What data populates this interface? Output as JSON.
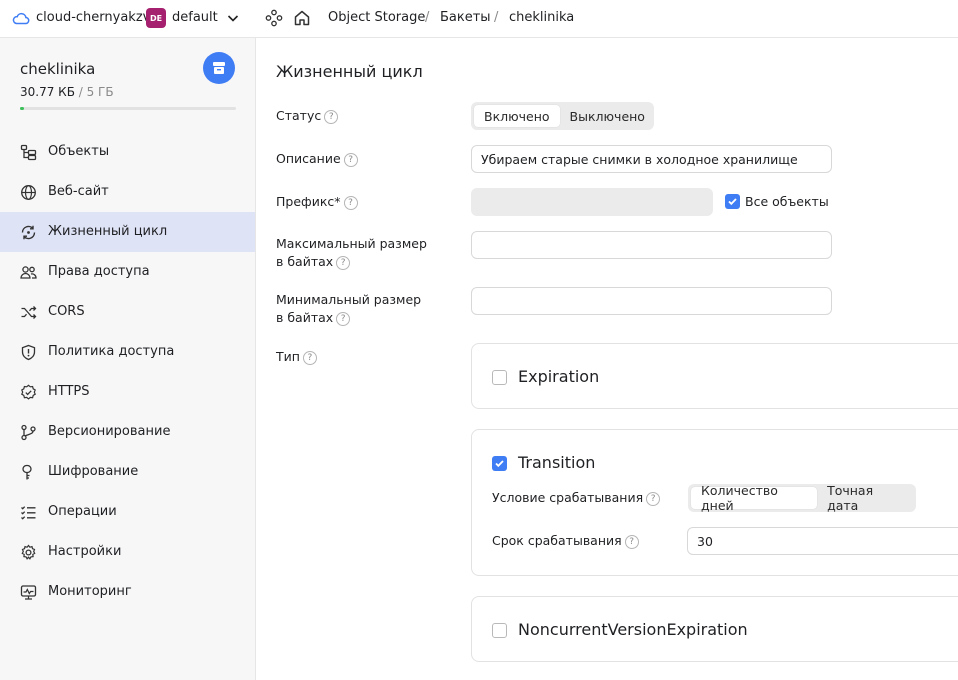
{
  "topbar": {
    "cloud_name": "cloud-chernyakzv",
    "folder_badge": "DE",
    "folder_name": "default",
    "breadcrumbs": [
      "Object Storage",
      "Бакеты",
      "cheklinika"
    ],
    "separator": "/"
  },
  "sidebar": {
    "bucket_name": "cheklinika",
    "usage_used": "30.77 КБ",
    "usage_total": "/ 5 ГБ",
    "usage_fraction": 0.02,
    "items": [
      {
        "label": "Объекты",
        "icon": "objects-icon",
        "active": false
      },
      {
        "label": "Веб-сайт",
        "icon": "globe-icon",
        "active": false
      },
      {
        "label": "Жизненный цикл",
        "icon": "lifecycle-icon",
        "active": true
      },
      {
        "label": "Права доступа",
        "icon": "users-icon",
        "active": false
      },
      {
        "label": "CORS",
        "icon": "shuffle-icon",
        "active": false
      },
      {
        "label": "Политика доступа",
        "icon": "shield-icon",
        "active": false
      },
      {
        "label": "HTTPS",
        "icon": "badge-check-icon",
        "active": false
      },
      {
        "label": "Версионирование",
        "icon": "branch-icon",
        "active": false
      },
      {
        "label": "Шифрование",
        "icon": "key-icon",
        "active": false
      },
      {
        "label": "Операции",
        "icon": "list-check-icon",
        "active": false
      },
      {
        "label": "Настройки",
        "icon": "gear-icon",
        "active": false
      },
      {
        "label": "Мониторинг",
        "icon": "monitor-icon",
        "active": false
      }
    ]
  },
  "form": {
    "title": "Жизненный цикл",
    "help_glyph": "?",
    "status": {
      "label": "Статус",
      "options": [
        "Включено",
        "Выключено"
      ],
      "selected": "Включено"
    },
    "description": {
      "label": "Описание",
      "value": "Убираем старые снимки в холодное хранилище"
    },
    "prefix": {
      "label": "Префикс*",
      "value": "",
      "all_objects_label": "Все объекты",
      "all_objects_checked": true
    },
    "max_size": {
      "label_line1": "Максимальный размер",
      "label_line2": "в байтах",
      "value": ""
    },
    "min_size": {
      "label_line1": "Минимальный размер",
      "label_line2": "в байтах",
      "value": ""
    },
    "type": {
      "label": "Тип"
    },
    "rules": {
      "expiration": {
        "title": "Expiration",
        "checked": false
      },
      "transition": {
        "title": "Transition",
        "checked": true,
        "trigger_label": "Условие срабатывания",
        "trigger_options": [
          "Количество дней",
          "Точная дата"
        ],
        "trigger_selected": "Количество дней",
        "period_label": "Срок срабатывания",
        "period_value": "30"
      },
      "noncurrent": {
        "title": "NoncurrentVersionExpiration",
        "checked": false
      }
    }
  },
  "colors": {
    "accent": "#3f7df5",
    "active_nav": "#dfe3f6",
    "badge": "#a5216f",
    "progress": "#3cbf5a"
  }
}
